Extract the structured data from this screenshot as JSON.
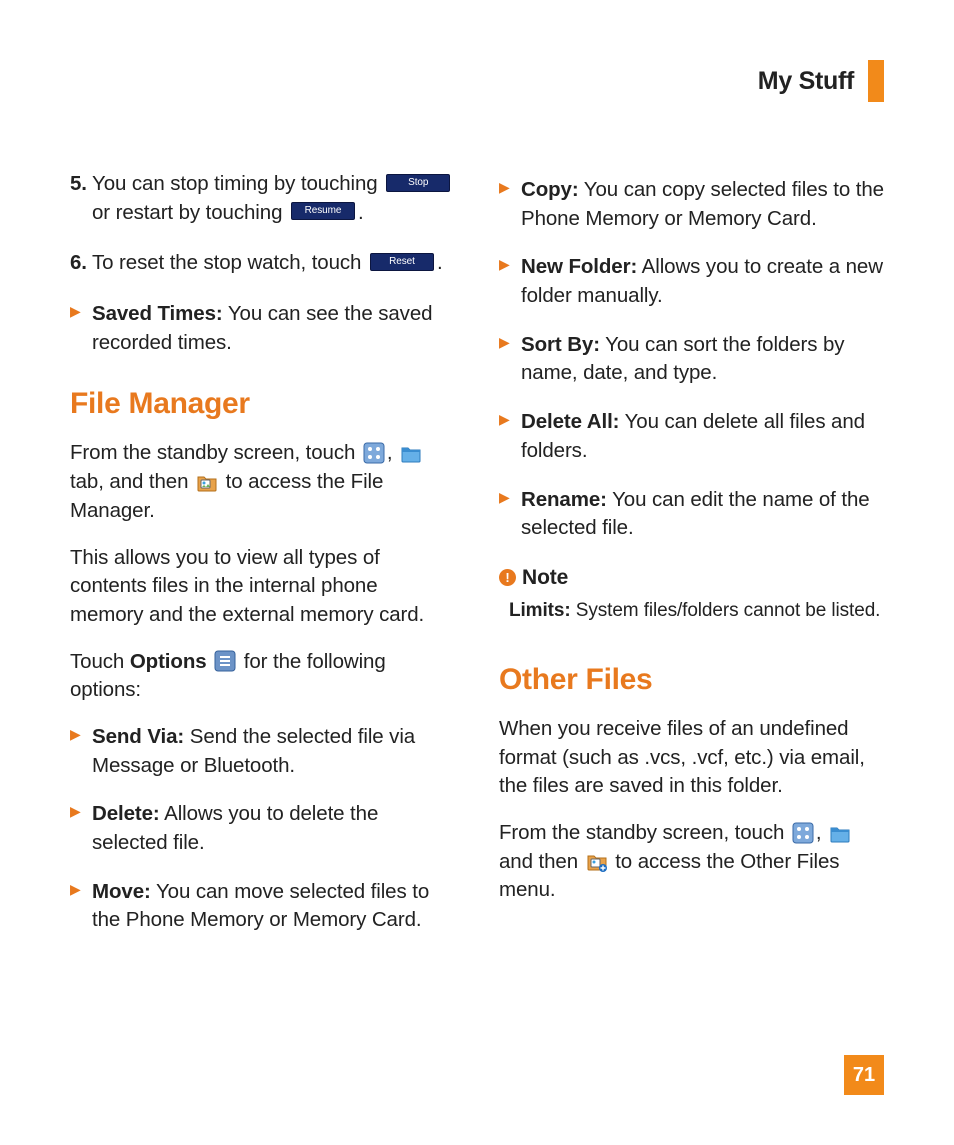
{
  "header": {
    "title": "My Stuff"
  },
  "page_number": "71",
  "left": {
    "steps": [
      {
        "num": "5.",
        "pre": "You can stop timing by touching ",
        "btn1": "Stop",
        "mid": " or restart by touching ",
        "btn2": "Resume",
        "post": "."
      },
      {
        "num": "6.",
        "pre": "To reset the stop watch, touch ",
        "btn1": "Reset",
        "post": "."
      }
    ],
    "saved_times": {
      "label": "Saved Times:",
      "text": " You can see the saved recorded times."
    },
    "h_file_manager": "File Manager",
    "fm_p1": {
      "a": "From the standby screen, touch ",
      "b": ", ",
      "c": " tab, and then ",
      "d": " to access the File Manager."
    },
    "fm_p2": "This allows you to view all types of contents files in the internal phone memory and the external memory card.",
    "fm_p3": {
      "a": "Touch ",
      "options": "Options",
      "b": " for the following options:"
    },
    "fm_opts": [
      {
        "label": "Send Via:",
        "text": " Send the selected file via Message or Bluetooth."
      },
      {
        "label": "Delete:",
        "text": " Allows you to delete the selected file."
      },
      {
        "label": "Move:",
        "text": " You can move selected files to the Phone Memory or Memory Card."
      }
    ]
  },
  "right": {
    "fm_opts2": [
      {
        "label": "Copy:",
        "text": " You can copy selected files to the Phone Memory or Memory Card."
      },
      {
        "label": "New Folder:",
        "text": " Allows you to create a new folder manually."
      },
      {
        "label": "Sort By:",
        "text": " You can sort the folders by name, date, and type."
      },
      {
        "label": "Delete All:",
        "text": " You can delete all files and folders."
      },
      {
        "label": "Rename:",
        "text": " You can edit the name of the selected file."
      }
    ],
    "note": {
      "head": "Note",
      "label": "Limits:",
      "text": " System files/folders cannot be listed."
    },
    "h_other": "Other Files",
    "other_p1": "When you receive files of an undefined format (such as .vcs, .vcf, etc.) via email, the files are saved in this folder.",
    "other_p2": {
      "a": "From the standby screen, touch ",
      "b": ", ",
      "c": " and then ",
      "d": " to access the Other Files menu."
    }
  }
}
